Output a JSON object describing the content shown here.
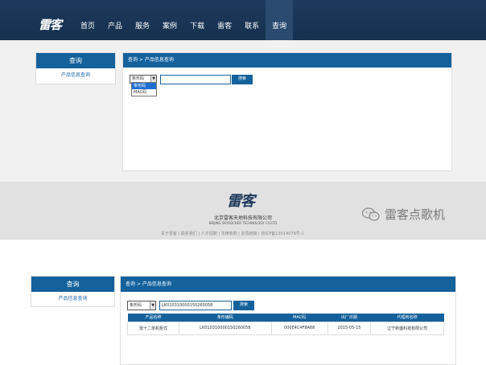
{
  "top": {
    "logo": "雷客",
    "nav": [
      "首页",
      "产品",
      "服务",
      "案例",
      "下载",
      "雷客",
      "联系",
      "查询"
    ],
    "active_nav": "查询",
    "sidebar": {
      "title": "查询",
      "item": "产品信息查询"
    },
    "breadcrumb": "查询 > 产品信息查询",
    "select_value": "条形码",
    "dropdown_options": [
      "条形码",
      "MAC码"
    ],
    "search_value": "",
    "search_button": "搜索",
    "footer": {
      "logo": "雷客",
      "company": "北京雷客天地科技有限公司",
      "company_en": "BEIJING SKYROCKER TECHNOLOGY CO.LTD",
      "links": "关于雷客 | 联系我们 | 人才招聘 | 法律条款 | 友情链接 | 京ICP备13014079号-1"
    },
    "watermark": "雷客点歌机"
  },
  "bottom": {
    "sidebar": {
      "title": "查询",
      "item": "产品信息查询"
    },
    "breadcrumb": "查询 > 产品信息查询",
    "select_value": "条形码",
    "search_value": "LK010310000150260058",
    "search_button": "搜索",
    "table": {
      "headers": [
        "产品名称",
        "条形编码",
        "MAC码",
        "出厂日期",
        "代理商名称"
      ],
      "rows": [
        [
          "雷十二单机柜式",
          "LK010310000150260058",
          "000E4C4F8A68",
          "2015-05-15",
          "辽宁新盛科技有限公司"
        ]
      ]
    }
  },
  "colors": {
    "primary": "#14619c",
    "header": "#1d3a5c"
  }
}
